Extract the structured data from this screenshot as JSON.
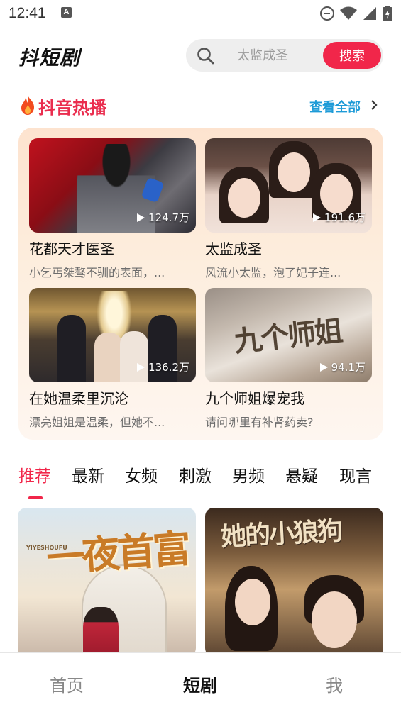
{
  "status_bar": {
    "time": "12:41",
    "notification_letter": "A"
  },
  "header": {
    "logo": "抖短剧",
    "search_placeholder": "太监成圣",
    "search_button": "搜索"
  },
  "hot_section": {
    "title": "抖音热播",
    "view_all": "查看全部",
    "items": [
      {
        "name": "花都天才医圣",
        "desc": "小乞丐桀骜不驯的表面，...",
        "plays": "124.7万"
      },
      {
        "name": "太监成圣",
        "desc": "风流小太监，泡了妃子连...",
        "plays": "191.6万"
      },
      {
        "name": "在她温柔里沉沦",
        "desc": "漂亮姐姐是温柔，但她不...",
        "plays": "136.2万"
      },
      {
        "name": "九个师姐爆宠我",
        "desc": "请问哪里有补肾药卖?",
        "plays": "94.1万",
        "poster_text": "九个师姐"
      }
    ]
  },
  "category_tabs": [
    "推荐",
    "最新",
    "女频",
    "刺激",
    "男频",
    "悬疑",
    "现言"
  ],
  "active_category": "推荐",
  "drama_grid": [
    {
      "poster_title": "一夜首富",
      "poster_sub": "YIYESHOUFU"
    },
    {
      "poster_title": "她的小狼狗"
    }
  ],
  "bottom_nav": {
    "items": [
      "首页",
      "短剧",
      "我"
    ],
    "active": "短剧"
  },
  "colors": {
    "accent": "#f1264a",
    "link": "#1e9bd7",
    "panel": "#fde3cf"
  }
}
